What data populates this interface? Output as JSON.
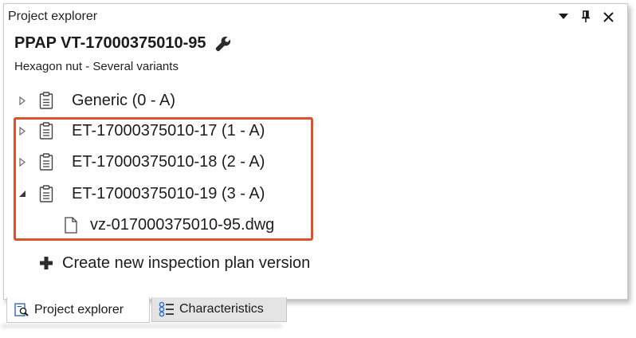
{
  "panel": {
    "title": "Project explorer",
    "controls": {
      "dropdown_icon": "dropdown-arrow-icon",
      "pin_icon": "pin-icon",
      "close_icon": "close-icon"
    }
  },
  "project": {
    "title": "PPAP VT-17000375010-95",
    "title_icon": "wrench-icon",
    "subtitle": "Hexagon nut - Several variants"
  },
  "tree": {
    "items": [
      {
        "label": "Generic (0 - A)",
        "expanded": false,
        "icon": "clipboard-icon"
      },
      {
        "label": "ET-17000375010-17 (1 - A)",
        "expanded": false,
        "icon": "clipboard-icon"
      },
      {
        "label": "ET-17000375010-18 (2 - A)",
        "expanded": false,
        "icon": "clipboard-icon"
      },
      {
        "label": "ET-17000375010-19 (3 - A)",
        "expanded": true,
        "icon": "clipboard-icon",
        "children": [
          {
            "label": "vz-017000375010-95.dwg",
            "icon": "file-icon"
          }
        ]
      }
    ],
    "highlight_color": "#d9532c"
  },
  "actions": {
    "create_label": "Create new inspection plan version",
    "create_icon": "plus-icon"
  },
  "tabs": [
    {
      "label": "Project explorer",
      "icon": "project-explorer-icon",
      "active": true
    },
    {
      "label": "Characteristics",
      "icon": "characteristics-icon",
      "active": false
    }
  ]
}
